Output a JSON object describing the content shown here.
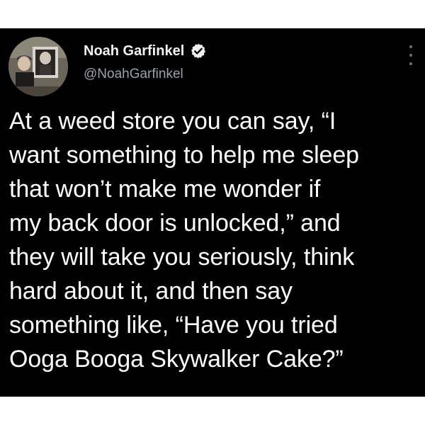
{
  "tweet": {
    "author": {
      "name": "Noah Garfinkel",
      "handle": "@NoahGarfinkel",
      "verified": true,
      "avatar_icon": "profile-photo"
    },
    "more_icon": "more-options-icon",
    "lines": [
      "At a weed store you can say, “I",
      "want something to help me sleep",
      "that won’t make me wonder if",
      "my back door is unlocked,” and",
      "they will take you seriously, think",
      "hard about it, and then say",
      "something like, “Have you tried",
      "Ooga Booga Skywalker Cake?”"
    ]
  },
  "colors": {
    "card_background": "#000000",
    "page_background": "#ffffff",
    "text_primary": "#ffffff",
    "text_secondary": "#9aa1a8",
    "verified_badge": "#f0f0f0"
  }
}
